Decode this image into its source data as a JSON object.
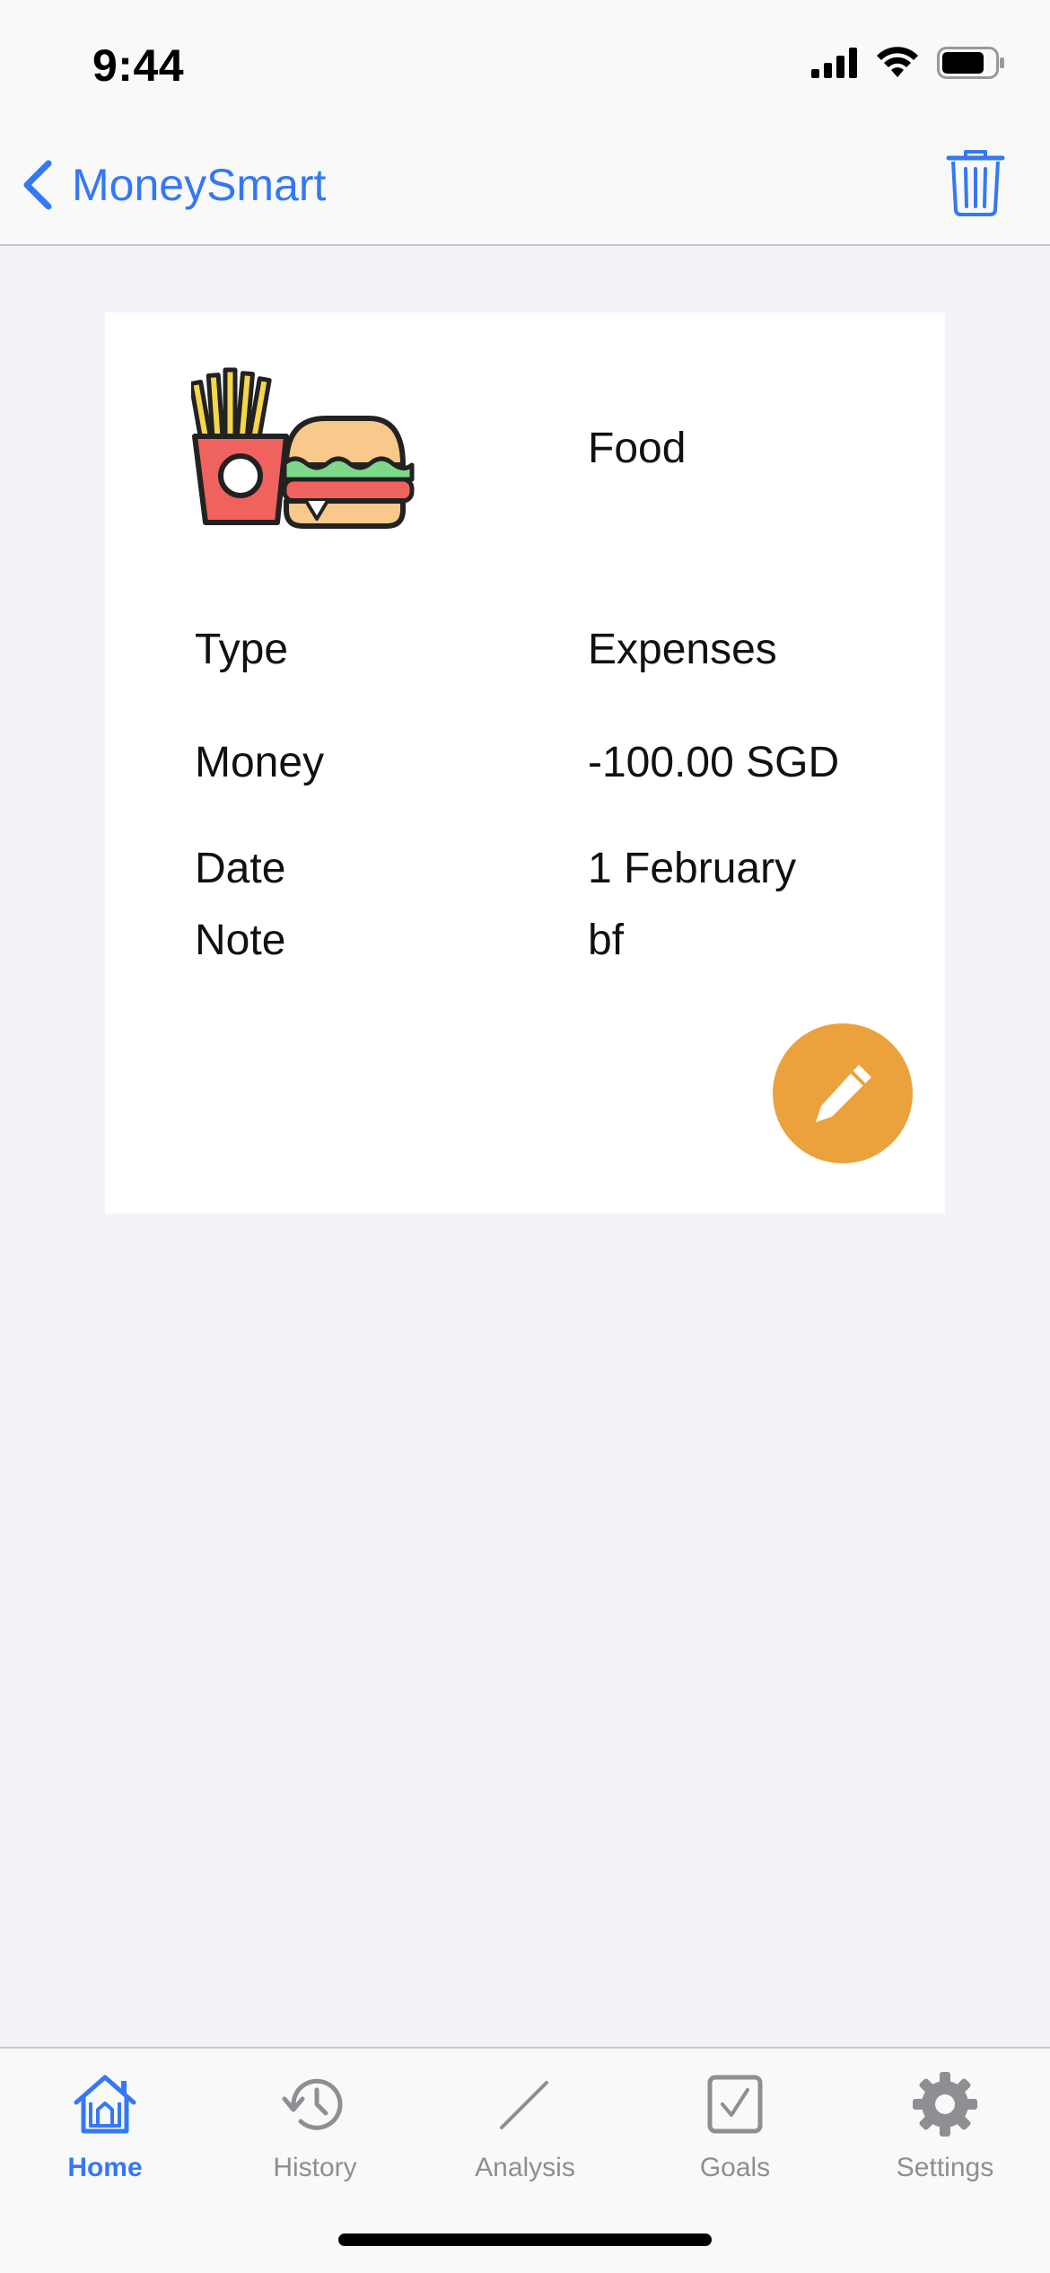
{
  "status_bar": {
    "time": "9:44"
  },
  "nav": {
    "back_label": "MoneySmart",
    "trash_icon": "trash-icon",
    "accent_color": "#3478f6"
  },
  "detail": {
    "category": "Food",
    "category_icon": "fast-food-icon",
    "rows": [
      {
        "label": "Type",
        "value": "Expenses"
      },
      {
        "label": "Money",
        "value": "-100.00 SGD"
      },
      {
        "label": "Date",
        "value": "1 February"
      },
      {
        "label": "Note",
        "value": "bf"
      }
    ],
    "edit_icon": "pencil-icon",
    "edit_button_color": "#eba23c"
  },
  "tabs": [
    {
      "label": "Home",
      "icon": "home-icon",
      "active": true
    },
    {
      "label": "History",
      "icon": "history-icon",
      "active": false
    },
    {
      "label": "Analysis",
      "icon": "analysis-icon",
      "active": false
    },
    {
      "label": "Goals",
      "icon": "goals-icon",
      "active": false
    },
    {
      "label": "Settings",
      "icon": "gear-icon",
      "active": false
    }
  ]
}
